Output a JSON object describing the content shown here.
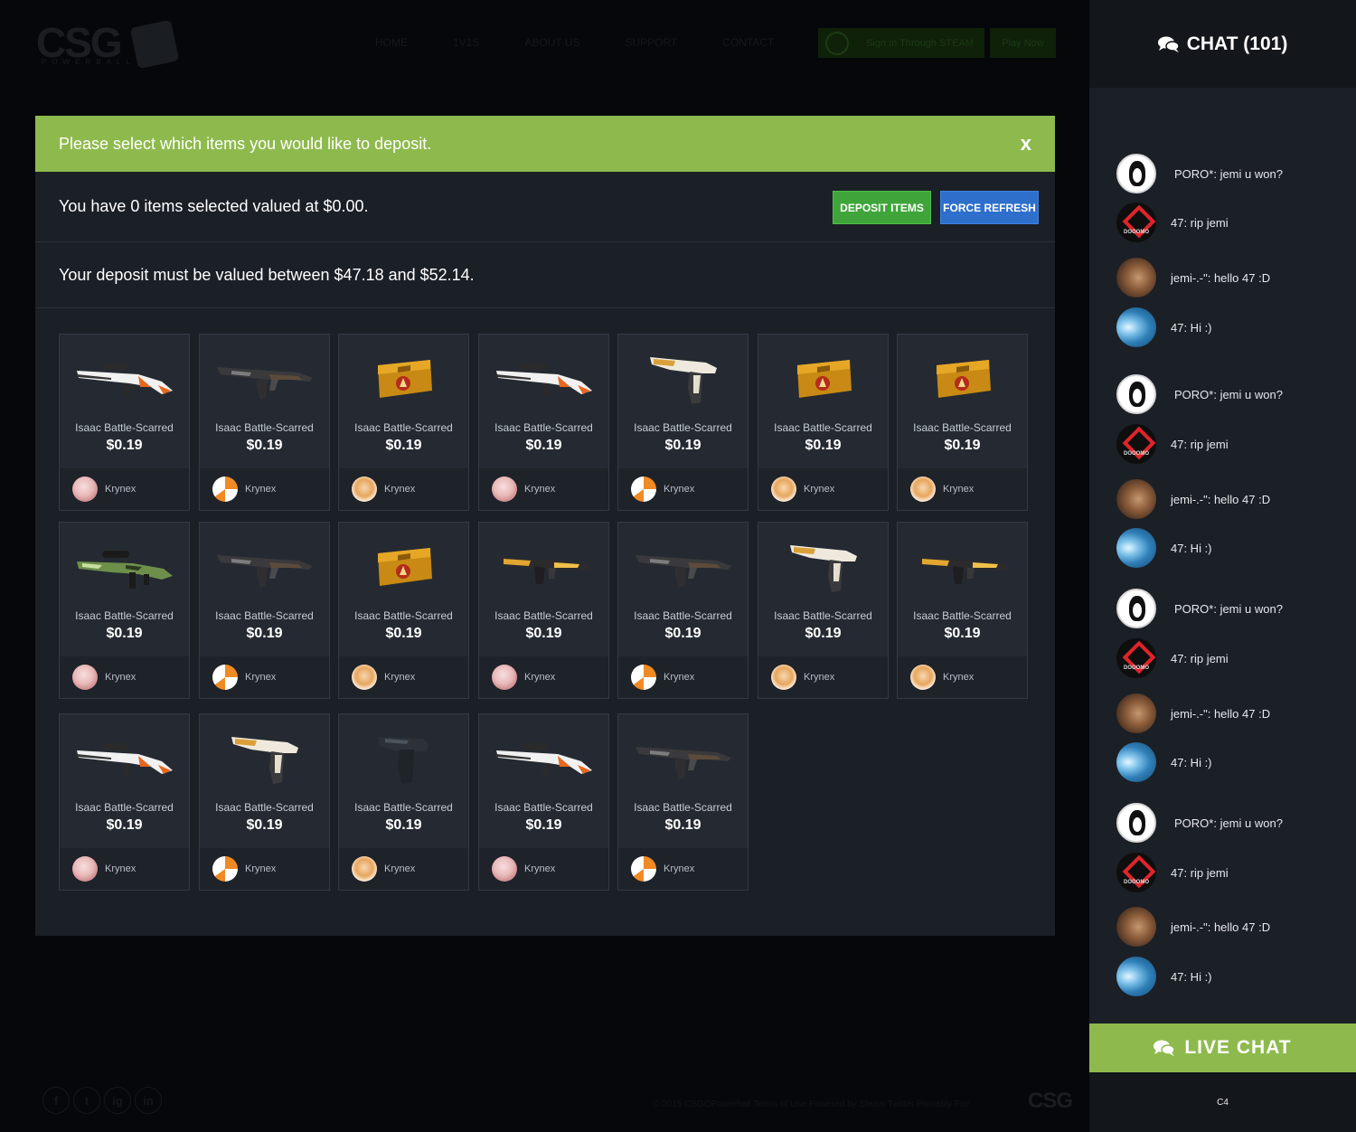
{
  "background": {
    "logo_text": "CSG",
    "logo_sub": "POWERBALL",
    "nav": [
      "HOME",
      "1V1S",
      "ABOUT US",
      "SUPPORT",
      "CONTACT"
    ],
    "steam_label": "Sign In Through STEAM",
    "play_label": "Play Now",
    "social_icons": [
      "f",
      "t",
      "ig",
      "in"
    ],
    "footer_text": "© 2015 CSGOPowerball Terms of Use Powered by Steam Twitter Provably Fair",
    "footer_logo": "CSG"
  },
  "modal": {
    "banner": "Please select which items you would like to deposit.",
    "close_label": "x",
    "summary": "You have 0 items selected valued at $0.00.",
    "deposit_label": "DEPOSIT ITEMS",
    "refresh_label": "FORCE REFRESH",
    "range": "Your deposit must be valued between $47.18 and $52.14.",
    "items": [
      {
        "name": "Isaac Battle-Scarred",
        "price": "$0.19",
        "owner": "Krynex",
        "icon": "asiimov-sniper",
        "avatar": "pink"
      },
      {
        "name": "Isaac Battle-Scarred",
        "price": "$0.19",
        "owner": "Krynex",
        "icon": "ak47",
        "avatar": "swirl"
      },
      {
        "name": "Isaac Battle-Scarred",
        "price": "$0.19",
        "owner": "Krynex",
        "icon": "weapon-case",
        "avatar": "fox"
      },
      {
        "name": "Isaac Battle-Scarred",
        "price": "$0.19",
        "owner": "Krynex",
        "icon": "asiimov-sniper",
        "avatar": "pink"
      },
      {
        "name": "Isaac Battle-Scarred",
        "price": "$0.19",
        "owner": "Krynex",
        "icon": "desert-eagle",
        "avatar": "swirl"
      },
      {
        "name": "Isaac Battle-Scarred",
        "price": "$0.19",
        "owner": "Krynex",
        "icon": "weapon-case",
        "avatar": "fox"
      },
      {
        "name": "Isaac Battle-Scarred",
        "price": "$0.19",
        "owner": "Krynex",
        "icon": "weapon-case",
        "avatar": "fox"
      },
      {
        "name": "Isaac Battle-Scarred",
        "price": "$0.19",
        "owner": "Krynex",
        "icon": "green-sniper",
        "avatar": "pink"
      },
      {
        "name": "Isaac Battle-Scarred",
        "price": "$0.19",
        "owner": "Krynex",
        "icon": "ak47",
        "avatar": "swirl"
      },
      {
        "name": "Isaac Battle-Scarred",
        "price": "$0.19",
        "owner": "Krynex",
        "icon": "weapon-case",
        "avatar": "fox"
      },
      {
        "name": "Isaac Battle-Scarred",
        "price": "$0.19",
        "owner": "Krynex",
        "icon": "smg",
        "avatar": "pink"
      },
      {
        "name": "Isaac Battle-Scarred",
        "price": "$0.19",
        "owner": "Krynex",
        "icon": "ak47",
        "avatar": "swirl"
      },
      {
        "name": "Isaac Battle-Scarred",
        "price": "$0.19",
        "owner": "Krynex",
        "icon": "desert-eagle",
        "avatar": "fox"
      },
      {
        "name": "Isaac Battle-Scarred",
        "price": "$0.19",
        "owner": "Krynex",
        "icon": "smg",
        "avatar": "fox"
      },
      {
        "name": "Isaac Battle-Scarred",
        "price": "$0.19",
        "owner": "Krynex",
        "icon": "asiimov-sniper",
        "avatar": "pink"
      },
      {
        "name": "Isaac Battle-Scarred",
        "price": "$0.19",
        "owner": "Krynex",
        "icon": "desert-eagle",
        "avatar": "swirl"
      },
      {
        "name": "Isaac Battle-Scarred",
        "price": "$0.19",
        "owner": "Krynex",
        "icon": "pistol",
        "avatar": "fox"
      },
      {
        "name": "Isaac Battle-Scarred",
        "price": "$0.19",
        "owner": "Krynex",
        "icon": "asiimov-sniper",
        "avatar": "pink"
      },
      {
        "name": "Isaac Battle-Scarred",
        "price": "$0.19",
        "owner": "Krynex",
        "icon": "ak47",
        "avatar": "swirl"
      }
    ]
  },
  "chat": {
    "title": "CHAT (101)",
    "messages": [
      {
        "text": "PORO*: jemi u won?",
        "avatar": "penguin"
      },
      {
        "text": "47: rip jemi",
        "avatar": "red"
      },
      {
        "text": "jemi-.-\": hello 47 :D",
        "avatar": "cat"
      },
      {
        "text": "47: Hi :)",
        "avatar": "blue"
      },
      {
        "text": "PORO*: jemi u won?",
        "avatar": "penguin"
      },
      {
        "text": "47: rip jemi",
        "avatar": "red"
      },
      {
        "text": "jemi-.-\": hello 47 :D",
        "avatar": "cat"
      },
      {
        "text": "47: Hi :)",
        "avatar": "blue"
      },
      {
        "text": "PORO*: jemi u won?",
        "avatar": "penguin"
      },
      {
        "text": "47: rip jemi",
        "avatar": "red"
      },
      {
        "text": "jemi-.-\": hello 47 :D",
        "avatar": "cat"
      },
      {
        "text": "47: Hi :)",
        "avatar": "blue"
      },
      {
        "text": "PORO*: jemi u won?",
        "avatar": "penguin"
      },
      {
        "text": "47: rip jemi",
        "avatar": "red"
      },
      {
        "text": "jemi-.-\": hello 47 :D",
        "avatar": "cat"
      },
      {
        "text": "47: Hi :)",
        "avatar": "blue"
      }
    ],
    "live_chat_label": "LIVE  CHAT",
    "footer_text": "C4"
  },
  "colors": {
    "accent_green": "#8eba4d",
    "deposit_green": "#3fa53a",
    "refresh_blue": "#2e6fcc",
    "panel": "#1b1f26"
  }
}
